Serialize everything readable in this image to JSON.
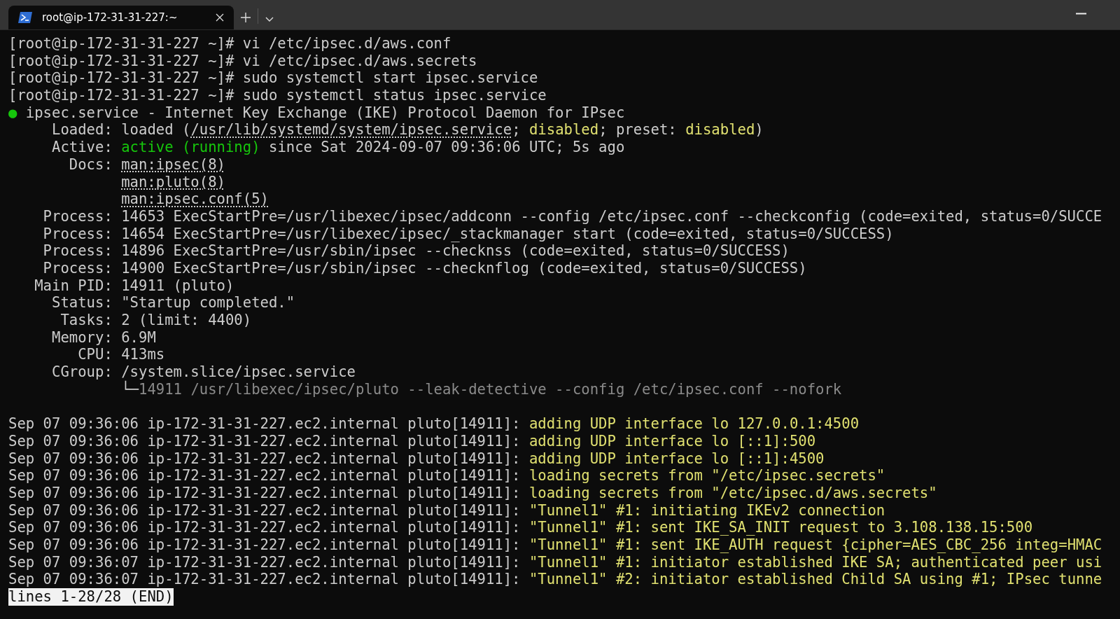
{
  "tab": {
    "title": "root@ip-172-31-31-227:~",
    "selected": true
  },
  "lines": [
    {
      "kind": "text",
      "segments": [
        {
          "kind": "plain",
          "text": "[root@ip-172-31-31-227 ~]# vi /etc/ipsec.d/aws.conf"
        }
      ]
    },
    {
      "kind": "text",
      "segments": [
        {
          "kind": "plain",
          "text": "[root@ip-172-31-31-227 ~]# vi /etc/ipsec.d/aws.secrets"
        }
      ]
    },
    {
      "kind": "text",
      "segments": [
        {
          "kind": "plain",
          "text": "[root@ip-172-31-31-227 ~]# sudo systemctl start ipsec.service"
        }
      ]
    },
    {
      "kind": "text",
      "segments": [
        {
          "kind": "plain",
          "text": "[root@ip-172-31-31-227 ~]# sudo systemctl status ipsec.service"
        }
      ]
    },
    {
      "kind": "text",
      "segments": [
        {
          "kind": "green",
          "text": "●"
        },
        {
          "kind": "plain",
          "text": " ipsec.service - Internet Key Exchange (IKE) Protocol Daemon for IPsec"
        }
      ]
    },
    {
      "kind": "text",
      "segments": [
        {
          "kind": "plain",
          "text": "     Loaded: loaded ("
        },
        {
          "kind": "link",
          "text": "/usr/lib/systemd/system/ipsec.service"
        },
        {
          "kind": "plain",
          "text": "; "
        },
        {
          "kind": "yellow",
          "text": "disabled"
        },
        {
          "kind": "plain",
          "text": "; preset: "
        },
        {
          "kind": "yellow",
          "text": "disabled"
        },
        {
          "kind": "plain",
          "text": ")"
        }
      ]
    },
    {
      "kind": "text",
      "segments": [
        {
          "kind": "plain",
          "text": "     Active: "
        },
        {
          "kind": "green",
          "text": "active (running)"
        },
        {
          "kind": "plain",
          "text": " since Sat 2024-09-07 09:36:06 UTC; 5s ago"
        }
      ]
    },
    {
      "kind": "text",
      "segments": [
        {
          "kind": "plain",
          "text": "       Docs: "
        },
        {
          "kind": "link",
          "text": "man:ipsec(8)"
        }
      ]
    },
    {
      "kind": "continuation",
      "segments": [
        {
          "kind": "link",
          "text": "man:pluto(8)"
        }
      ]
    },
    {
      "kind": "continuation",
      "segments": [
        {
          "kind": "link",
          "text": "man:ipsec.conf(5)"
        }
      ]
    },
    {
      "kind": "text",
      "segments": [
        {
          "kind": "plain",
          "text": "    Process: 14653 ExecStartPre=/usr/libexec/ipsec/addconn --config /etc/ipsec.conf --checkconfig (code=exited, status=0/SUCCE"
        }
      ]
    },
    {
      "kind": "text",
      "segments": [
        {
          "kind": "plain",
          "text": "    Process: 14654 ExecStartPre=/usr/libexec/ipsec/_stackmanager start (code=exited, status=0/SUCCESS)"
        }
      ]
    },
    {
      "kind": "text",
      "segments": [
        {
          "kind": "plain",
          "text": "    Process: 14896 ExecStartPre=/usr/sbin/ipsec --checknss (code=exited, status=0/SUCCESS)"
        }
      ]
    },
    {
      "kind": "text",
      "segments": [
        {
          "kind": "plain",
          "text": "    Process: 14900 ExecStartPre=/usr/sbin/ipsec --checknflog (code=exited, status=0/SUCCESS)"
        }
      ]
    },
    {
      "kind": "text",
      "segments": [
        {
          "kind": "plain",
          "text": "   Main PID: 14911 (pluto)"
        }
      ]
    },
    {
      "kind": "text",
      "segments": [
        {
          "kind": "plain",
          "text": "     Status: \"Startup completed.\""
        }
      ]
    },
    {
      "kind": "text",
      "segments": [
        {
          "kind": "plain",
          "text": "      Tasks: 2 (limit: 4400)"
        }
      ]
    },
    {
      "kind": "text",
      "segments": [
        {
          "kind": "plain",
          "text": "     Memory: 6.9M"
        }
      ]
    },
    {
      "kind": "text",
      "segments": [
        {
          "kind": "plain",
          "text": "        CPU: 413ms"
        }
      ]
    },
    {
      "kind": "text",
      "segments": [
        {
          "kind": "plain",
          "text": "     CGroup: /system.slice/ipsec.service"
        }
      ]
    },
    {
      "kind": "continuation",
      "segments": [
        {
          "kind": "plain",
          "text": "└─"
        },
        {
          "kind": "dim",
          "text": "14911 /usr/libexec/ipsec/pluto --leak-detective --config /etc/ipsec.conf --nofork"
        }
      ]
    },
    {
      "kind": "blank"
    },
    {
      "kind": "text",
      "segments": [
        {
          "kind": "plain",
          "text": "Sep 07 09:36:06 ip-172-31-31-227.ec2.internal pluto[14911]: "
        },
        {
          "kind": "yellow",
          "text": "adding UDP interface lo 127.0.0.1:4500"
        }
      ]
    },
    {
      "kind": "text",
      "segments": [
        {
          "kind": "plain",
          "text": "Sep 07 09:36:06 ip-172-31-31-227.ec2.internal pluto[14911]: "
        },
        {
          "kind": "yellow",
          "text": "adding UDP interface lo [::1]:500"
        }
      ]
    },
    {
      "kind": "text",
      "segments": [
        {
          "kind": "plain",
          "text": "Sep 07 09:36:06 ip-172-31-31-227.ec2.internal pluto[14911]: "
        },
        {
          "kind": "yellow",
          "text": "adding UDP interface lo [::1]:4500"
        }
      ]
    },
    {
      "kind": "text",
      "segments": [
        {
          "kind": "plain",
          "text": "Sep 07 09:36:06 ip-172-31-31-227.ec2.internal pluto[14911]: "
        },
        {
          "kind": "yellow",
          "text": "loading secrets from \"/etc/ipsec.secrets\""
        }
      ]
    },
    {
      "kind": "text",
      "segments": [
        {
          "kind": "plain",
          "text": "Sep 07 09:36:06 ip-172-31-31-227.ec2.internal pluto[14911]: "
        },
        {
          "kind": "yellow",
          "text": "loading secrets from \"/etc/ipsec.d/aws.secrets\""
        }
      ]
    },
    {
      "kind": "text",
      "segments": [
        {
          "kind": "plain",
          "text": "Sep 07 09:36:06 ip-172-31-31-227.ec2.internal pluto[14911]: "
        },
        {
          "kind": "yellow",
          "text": "\"Tunnel1\" #1: initiating IKEv2 connection"
        }
      ]
    },
    {
      "kind": "text",
      "segments": [
        {
          "kind": "plain",
          "text": "Sep 07 09:36:06 ip-172-31-31-227.ec2.internal pluto[14911]: "
        },
        {
          "kind": "yellow",
          "text": "\"Tunnel1\" #1: sent IKE_SA_INIT request to 3.108.138.15:500"
        }
      ]
    },
    {
      "kind": "text",
      "segments": [
        {
          "kind": "plain",
          "text": "Sep 07 09:36:06 ip-172-31-31-227.ec2.internal pluto[14911]: "
        },
        {
          "kind": "yellow",
          "text": "\"Tunnel1\" #1: sent IKE_AUTH request {cipher=AES_CBC_256 integ=HMAC"
        }
      ]
    },
    {
      "kind": "text",
      "segments": [
        {
          "kind": "plain",
          "text": "Sep 07 09:36:07 ip-172-31-31-227.ec2.internal pluto[14911]: "
        },
        {
          "kind": "yellow",
          "text": "\"Tunnel1\" #1: initiator established IKE SA; authenticated peer usi"
        }
      ]
    },
    {
      "kind": "text",
      "segments": [
        {
          "kind": "plain",
          "text": "Sep 07 09:36:07 ip-172-31-31-227.ec2.internal pluto[14911]: "
        },
        {
          "kind": "yellow",
          "text": "\"Tunnel1\" #2: initiator established Child SA using #1; IPsec tunne"
        }
      ]
    }
  ],
  "pager_status": "lines 1-28/28 (END)"
}
